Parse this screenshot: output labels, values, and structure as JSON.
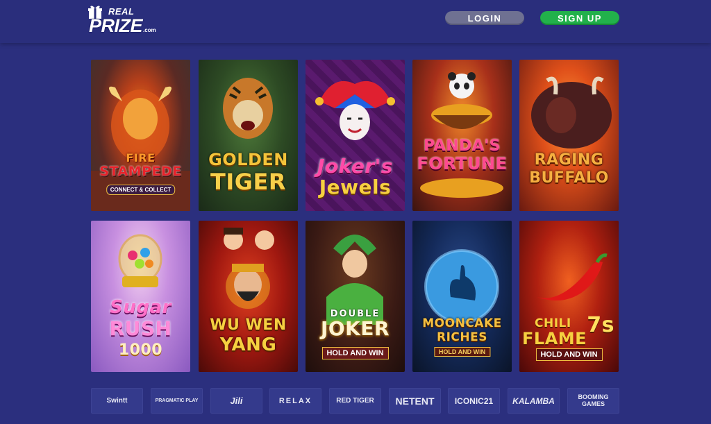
{
  "header": {
    "logo": {
      "top": "REAL",
      "main": "PRIZE",
      "suffix": ".com"
    },
    "login_label": "LOGIN",
    "signup_label": "SIGN UP"
  },
  "games": [
    {
      "title_1": "FIRE",
      "title_2": "STAMPEDE",
      "subtitle": "CONNECT & COLLECT"
    },
    {
      "title_1": "GOLDEN",
      "title_2": "TIGER"
    },
    {
      "title_1": "Joker's",
      "title_2": "Jewels"
    },
    {
      "title_1": "PANDA'S",
      "title_2": "FORTUNE"
    },
    {
      "title_1": "RAGING",
      "title_2": "BUFFALO"
    },
    {
      "title_1": "Sugar",
      "title_2": "RUSH",
      "title_3": "1000"
    },
    {
      "title_1": "WU WEN",
      "title_2": "YANG"
    },
    {
      "title_1": "DOUBLE",
      "title_2": "JOKER",
      "subtitle": "HOLD AND WIN"
    },
    {
      "title_1": "MOONCAKE",
      "title_2": "RICHES",
      "subtitle": "HOLD AND WIN"
    },
    {
      "title_1": "CHILI",
      "title_2": "FLAME",
      "title_3": "7s",
      "subtitle": "HOLD AND WIN"
    }
  ],
  "providers": [
    {
      "label": "Swintt"
    },
    {
      "label": "PRAGMATIC PLAY"
    },
    {
      "label": "Jili"
    },
    {
      "label": "RELAX"
    },
    {
      "label": "RED TIGER"
    },
    {
      "label": "NETENT"
    },
    {
      "label": "ICONIC21"
    },
    {
      "label": "KALAMBA"
    },
    {
      "label": "BOOMING GAMES"
    }
  ],
  "colors": {
    "background": "#2b2f7e",
    "signup": "#22b14b",
    "login": "#6f7192"
  }
}
